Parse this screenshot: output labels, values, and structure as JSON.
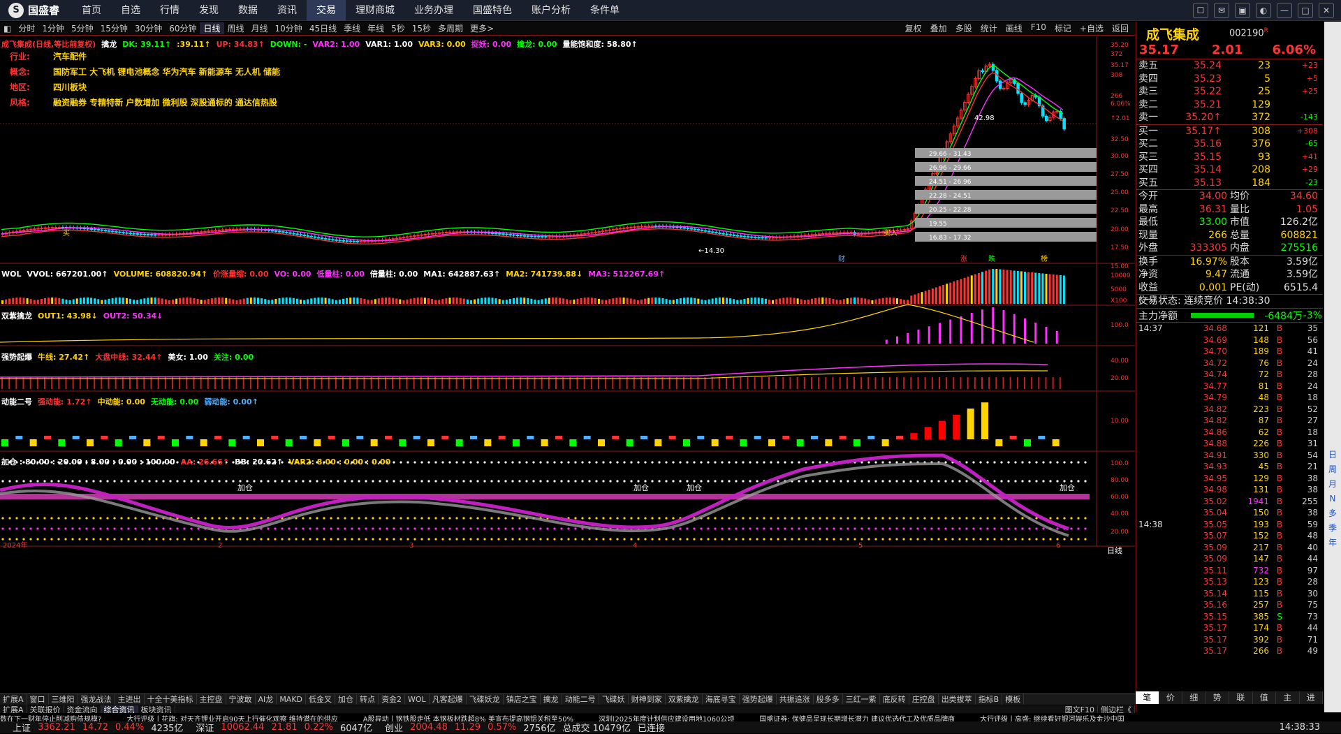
{
  "app": {
    "name": "国盛睿"
  },
  "menu": [
    "首页",
    "自选",
    "行情",
    "发现",
    "数据",
    "资讯",
    "交易",
    "理财商城",
    "业务办理",
    "国盛特色",
    "账户分析",
    "条件单"
  ],
  "menu_active": 6,
  "periods": [
    "分时",
    "1分钟",
    "5分钟",
    "15分钟",
    "30分钟",
    "60分钟",
    "日线",
    "周线",
    "月线",
    "10分钟",
    "45日线",
    "季线",
    "年线",
    "5秒",
    "15秒",
    "多周期",
    "更多>"
  ],
  "period_active": 6,
  "toolbar_right": [
    "复权",
    "叠加",
    "多股",
    "统计",
    "画线",
    "F10",
    "标记",
    "+自选",
    "返回"
  ],
  "main_info": {
    "title": "成飞集成(日线,等比前复权)",
    "indicator": "擒龙",
    "items": [
      {
        "t": "DK: 39.11↑",
        "c": "#00ff00"
      },
      {
        "t": ":39.11↑",
        "c": "#ffd400"
      },
      {
        "t": "UP: 34.83↑",
        "c": "#ff3030"
      },
      {
        "t": "DOWN: -",
        "c": "#00ff00"
      },
      {
        "t": "VAR2: 1.00",
        "c": "#ff30ff"
      },
      {
        "t": "VAR1: 1.00",
        "c": "#ffffff"
      },
      {
        "t": "VAR3: 0.00",
        "c": "#ffd400"
      },
      {
        "t": "捉妖: 0.00",
        "c": "#ff30ff"
      },
      {
        "t": "擒龙: 0.00",
        "c": "#00ff00"
      },
      {
        "t": "量能饱和度: 58.80↑",
        "c": "#ffffff"
      }
    ]
  },
  "tags": [
    {
      "k": "行业:",
      "v": "汽车配件"
    },
    {
      "k": "概念:",
      "v": "国防军工 大飞机 锂电池概念 华为汽车 新能源车 无人机 储能"
    },
    {
      "k": "地区:",
      "v": "四川板块"
    },
    {
      "k": "风格:",
      "v": "融资融券 专精特新 户数增加 微利股 深股通标的 通达信热股"
    }
  ],
  "price_axis": [
    "35.20",
    "35.17",
    "32.50",
    "30.00",
    "27.50",
    "25.00",
    "22.50",
    "20.00",
    "17.50",
    "15.00"
  ],
  "price_axis_small": [
    "372",
    "308",
    "266",
    "6.06%",
    "↑2.01"
  ],
  "price_boxes": [
    "29.66 - 31.43",
    "26.96 - 29.66",
    "24.51 - 26.96",
    "22.28 - 24.51",
    "20.25 - 22.28",
    "19.55",
    "16.83 - 17.32"
  ],
  "price_labels": [
    "42.98",
    "←14.30",
    "买入",
    "财",
    "涨",
    "跌",
    "榜",
    "买"
  ],
  "panels": {
    "wol": {
      "items": [
        {
          "t": "WOL",
          "c": "#ffffff"
        },
        {
          "t": "VVOL: 667201.00↑",
          "c": "#ffffff"
        },
        {
          "t": "VOLUME: 608820.94↑",
          "c": "#ffd400"
        },
        {
          "t": "价涨量缩: 0.00",
          "c": "#ff3030"
        },
        {
          "t": "VO: 0.00",
          "c": "#ff30ff"
        },
        {
          "t": "低量柱: 0.00",
          "c": "#ff30ff"
        },
        {
          "t": "倍量柱: 0.00",
          "c": "#ffffff"
        },
        {
          "t": "MA1: 642887.63↑",
          "c": "#ffffff"
        },
        {
          "t": "MA2: 741739.88↓",
          "c": "#ffd400"
        },
        {
          "t": "MA3: 512267.69↑",
          "c": "#ff30ff"
        }
      ],
      "axis": [
        "10000",
        "5000",
        "X100"
      ]
    },
    "szql": {
      "items": [
        {
          "t": "双紫擒龙",
          "c": "#ffffff"
        },
        {
          "t": "OUT1: 43.98↓",
          "c": "#ffd400"
        },
        {
          "t": "OUT2: 50.34↓",
          "c": "#ff30ff"
        }
      ],
      "axis": [
        "100.0"
      ]
    },
    "qsqb": {
      "items": [
        {
          "t": "强势起爆",
          "c": "#ffffff"
        },
        {
          "t": "牛线: 27.42↑",
          "c": "#ffd400"
        },
        {
          "t": "大盘中线: 32.44↑",
          "c": "#ff3030"
        },
        {
          "t": "美女: 1.00",
          "c": "#ffffff"
        },
        {
          "t": "关注: 0.00",
          "c": "#00ff00"
        }
      ],
      "axis": [
        "40.00",
        "20.00"
      ]
    },
    "dne": {
      "items": [
        {
          "t": "动能二号",
          "c": "#ffffff"
        },
        {
          "t": "强动能: 1.72↑",
          "c": "#ff3030"
        },
        {
          "t": "中动能: 0.00",
          "c": "#ffd400"
        },
        {
          "t": "无动能: 0.00",
          "c": "#00ff00"
        },
        {
          "t": "弱动能: 0.00↑",
          "c": "#4fb0ff"
        }
      ],
      "axis": [
        "10.00"
      ]
    },
    "jc": {
      "items": [
        {
          "t": "加仓 : 80.00 : 20.00 : 8.00 : 0.00 : 100.00",
          "c": "#ffffff"
        },
        {
          "t": "AA: 26.66↑",
          "c": "#ff3030"
        },
        {
          "t": "BB: 20.62↑",
          "c": "#ffffff"
        },
        {
          "t": "VAR2: 8.00 : 0.00 : 0.00",
          "c": "#ffd400"
        }
      ],
      "axis": [
        "100.0",
        "80.00",
        "60.00",
        "40.00",
        "20.00"
      ],
      "labels": [
        "加仓",
        "加仓",
        "加仓",
        "加仓"
      ],
      "dates": [
        "2024年",
        "2",
        "3",
        "4",
        "5",
        "6"
      ],
      "period_label": "日线"
    }
  },
  "tabbar1": [
    "扩展A",
    "窗口",
    "三维阳",
    "强龙战法",
    "主进出",
    "十全十美指标",
    "主控盘",
    "宁波敢",
    "AI龙",
    "MAKD",
    "低金叉",
    "加仓",
    "转点",
    "资金2",
    "WOL",
    "凡客起爆",
    "飞碟妖龙",
    "镇店之宝",
    "擒龙",
    "动能二号",
    "飞碟妖",
    "财神到家",
    "双紫擒龙",
    "海底寻宝",
    "强势起爆",
    "共振追涨",
    "股多多",
    "三红一紫",
    "底反转",
    "庄控盘",
    "出类拔萃",
    "指标B",
    "模板"
  ],
  "tabbar2": [
    "扩展A",
    "关联报价",
    "资金流向",
    "综合资讯",
    "板块资讯"
  ],
  "tabbar2_active": 3,
  "tabbar2_right": [
    "图文F10",
    "侧边栏《"
  ],
  "stock": {
    "name": "成飞集成",
    "code": "002190",
    "price": "35.17",
    "change": "2.01",
    "pct": "6.06%"
  },
  "asks": [
    {
      "l": "卖五",
      "p": "35.24",
      "v": "23",
      "d": "+23",
      "dc": "#ff3333"
    },
    {
      "l": "卖四",
      "p": "35.23",
      "v": "5",
      "d": "+5",
      "dc": "#ff3333"
    },
    {
      "l": "卖三",
      "p": "35.22",
      "v": "25",
      "d": "+25",
      "dc": "#ff3333"
    },
    {
      "l": "卖二",
      "p": "35.21",
      "v": "129",
      "d": "",
      "dc": "#ff3333"
    },
    {
      "l": "卖一",
      "p": "35.20↑",
      "v": "372",
      "d": "-143",
      "dc": "#00ff00"
    }
  ],
  "bids": [
    {
      "l": "买一",
      "p": "35.17↑",
      "v": "308",
      "d": "+308",
      "dc": "#ff3333"
    },
    {
      "l": "买二",
      "p": "35.16",
      "v": "376",
      "d": "-65",
      "dc": "#00ff00"
    },
    {
      "l": "买三",
      "p": "35.15",
      "v": "93",
      "d": "+41",
      "dc": "#ff3333"
    },
    {
      "l": "买四",
      "p": "35.14",
      "v": "208",
      "d": "+29",
      "dc": "#ff3333"
    },
    {
      "l": "买五",
      "p": "35.13",
      "v": "184",
      "d": "-23",
      "dc": "#00ff00"
    }
  ],
  "stats": [
    {
      "a": "今开",
      "b": "34.00",
      "bc": "#ff3333",
      "c": "均价",
      "d": "34.60",
      "dc": "#ff3333"
    },
    {
      "a": "最高",
      "b": "36.31",
      "bc": "#ff3333",
      "c": "量比",
      "d": "1.05",
      "dc": "#ff3333"
    },
    {
      "a": "最低",
      "b": "33.00",
      "bc": "#00ff00",
      "c": "市值",
      "d": "126.2亿",
      "dc": "#dddddd"
    },
    {
      "a": "现量",
      "b": "266",
      "bc": "#ffd400",
      "c": "总量",
      "d": "608821",
      "dc": "#ffd400"
    },
    {
      "a": "外盘",
      "b": "333305",
      "bc": "#ff3333",
      "c": "内盘",
      "d": "275516",
      "dc": "#00ff00"
    }
  ],
  "stats2": [
    {
      "a": "换手",
      "b": "16.97%",
      "bc": "#ffd400",
      "c": "股本",
      "d": "3.59亿",
      "dc": "#dddddd"
    },
    {
      "a": "净资",
      "b": "9.47",
      "bc": "#ffd400",
      "c": "流通",
      "d": "3.59亿",
      "dc": "#dddddd"
    },
    {
      "a": "收益(一)",
      "b": "0.001",
      "bc": "#ffd400",
      "c": "PE(动)",
      "d": "6515.4",
      "dc": "#dddddd"
    }
  ],
  "trade_state": "交易状态: 连续竞价 14:38:30",
  "main_money": {
    "label": "主力净额",
    "value": "-6484万",
    "pct": "-3%"
  },
  "ticks_1437": [
    [
      "34.68",
      "121",
      "B",
      "35"
    ],
    [
      "34.69",
      "148",
      "B",
      "56"
    ],
    [
      "34.70",
      "189",
      "B",
      "41"
    ],
    [
      "34.72",
      "76",
      "B",
      "24"
    ],
    [
      "34.74",
      "72",
      "B",
      "28"
    ],
    [
      "34.77",
      "81",
      "B",
      "24"
    ],
    [
      "34.79",
      "48",
      "B",
      "18"
    ],
    [
      "34.82",
      "223",
      "B",
      "52"
    ],
    [
      "34.82",
      "87",
      "B",
      "27"
    ],
    [
      "34.86",
      "62",
      "B",
      "18"
    ],
    [
      "34.88",
      "226",
      "B",
      "31"
    ],
    [
      "34.91",
      "330",
      "B",
      "54"
    ],
    [
      "34.93",
      "45",
      "B",
      "21"
    ],
    [
      "34.95",
      "129",
      "B",
      "38"
    ],
    [
      "34.98",
      "131",
      "B",
      "38"
    ],
    [
      "35.02",
      "1941",
      "B",
      "255"
    ],
    [
      "35.04",
      "150",
      "B",
      "38"
    ]
  ],
  "ticks_1438": [
    [
      "35.05",
      "193",
      "B",
      "59"
    ],
    [
      "35.07",
      "152",
      "B",
      "48"
    ],
    [
      "35.09",
      "217",
      "B",
      "40"
    ],
    [
      "35.09",
      "147",
      "B",
      "44"
    ],
    [
      "35.11",
      "732",
      "B",
      "97"
    ],
    [
      "35.13",
      "123",
      "B",
      "28"
    ],
    [
      "35.14",
      "115",
      "B",
      "30"
    ],
    [
      "35.16",
      "257",
      "B",
      "75"
    ],
    [
      "35.15",
      "385",
      "S",
      "73"
    ],
    [
      "35.17",
      "174",
      "B",
      "44"
    ],
    [
      "35.17",
      "392",
      "B",
      "71"
    ],
    [
      "35.17",
      "266",
      "B",
      "49"
    ]
  ],
  "tick_time1": "14:37",
  "tick_time2": "14:38",
  "right_tabs": [
    "笔",
    "价",
    "细",
    "势",
    "联",
    "值",
    "主",
    "进"
  ],
  "right_tabs_active": 0,
  "side_icons": [
    "日",
    "周",
    "月",
    "N",
    "多",
    "季",
    "年"
  ],
  "news": [
    "数在下一财年停止削减购债规模?",
    "大行评级丨花旗: 对天齐锂业开启90天上行催化观察 维持潜在的供应",
    "A股异动丨钢铁股走低 本钢板材跌超8% 美宣布提高钢铝关税至50%",
    "深圳|2025年度计划供应建设用地1060公顷",
    "国盛证券: 保健品呈现长期增长潜力 建议优选代工及优质品牌商",
    "大行评级丨高盛: 继续看好银河娱乐及金沙中国"
  ],
  "statusbar": [
    {
      "l": "上证",
      "v": "3362.21",
      "c": "14.72",
      "p": "0.44%",
      "a": "4235亿"
    },
    {
      "l": "深证",
      "v": "10062.44",
      "c": "21.81",
      "p": "0.22%",
      "a": "6047亿"
    },
    {
      "l": "创业",
      "v": "2004.48",
      "c": "11.29",
      "p": "0.57%",
      "a": "2756亿"
    }
  ],
  "status_total": "总成交 10479亿",
  "status_conn": "已连接",
  "status_time": "14:38:33",
  "colors": {
    "up": "#ff3333",
    "down": "#00ff00",
    "yellow": "#ffd400",
    "magenta": "#ff30ff",
    "border": "#8a1a1a"
  }
}
